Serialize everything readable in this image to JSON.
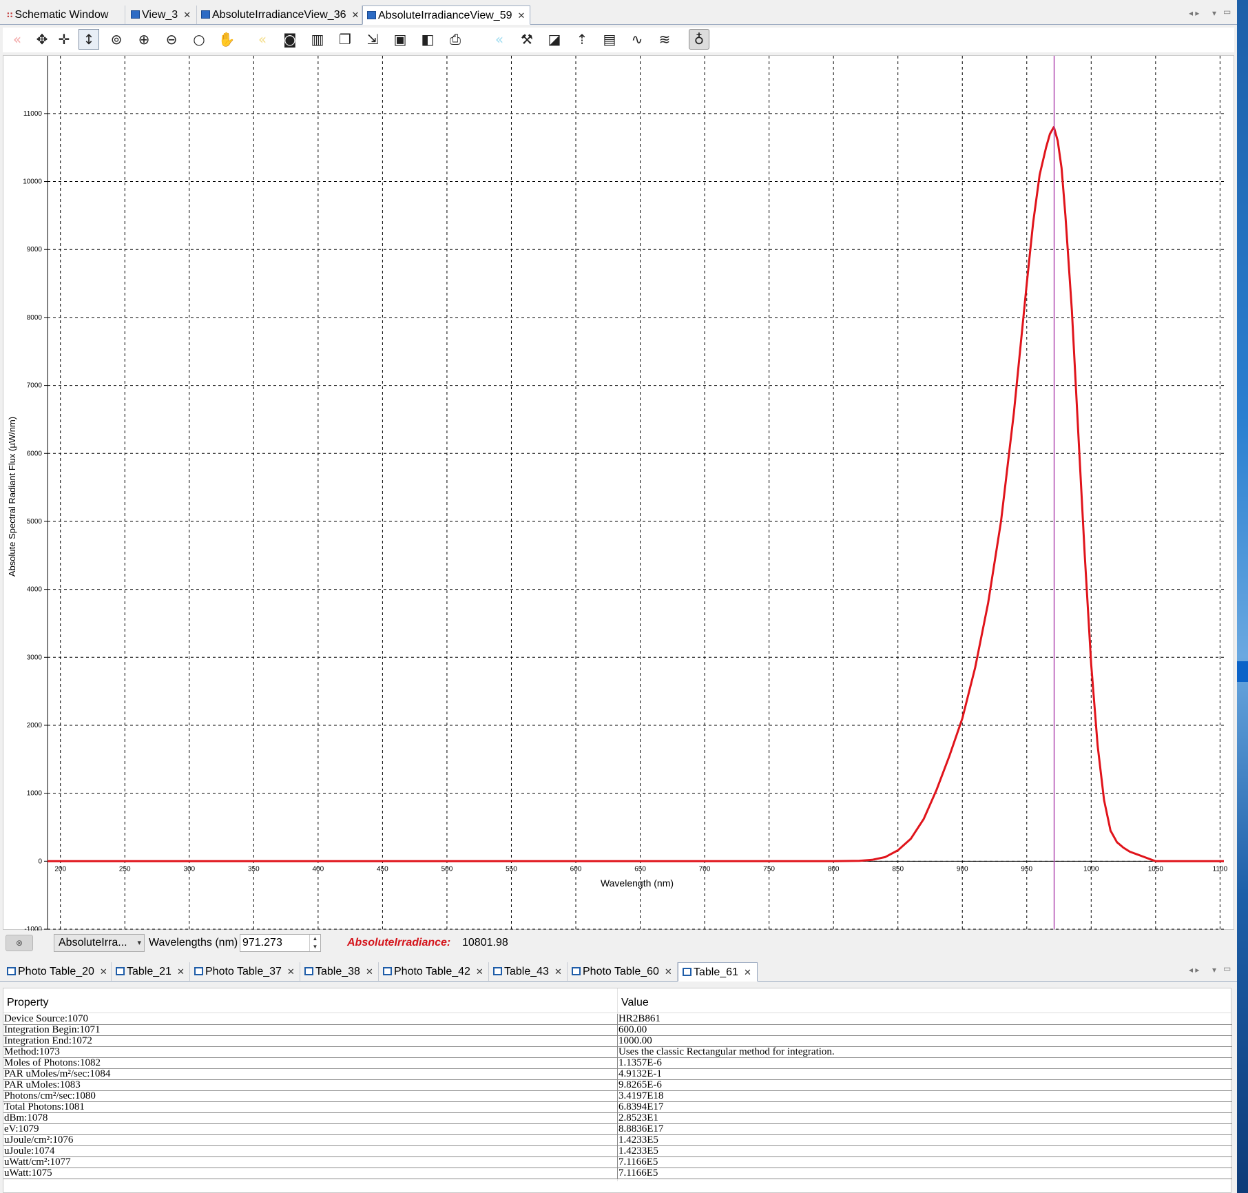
{
  "editor_tabs": [
    {
      "label": "Schematic Window",
      "icon": "schematic-dots-icon",
      "closable": false,
      "active": false
    },
    {
      "label": "View_3",
      "icon": "graph-view-icon",
      "closable": true,
      "active": false
    },
    {
      "label": "AbsoluteIrradianceView_36",
      "icon": "graph-view-icon",
      "closable": true,
      "active": false
    },
    {
      "label": "AbsoluteIrradianceView_59",
      "icon": "graph-view-icon",
      "closable": true,
      "active": true
    }
  ],
  "toolbar": {
    "buttons": [
      "back-icon",
      "pan-both-icon",
      "crosshair-icon",
      "vertical-cursor-icon",
      "zoom-auto-icon",
      "zoom-in-icon",
      "zoom-out-icon",
      "zoom-fit-icon",
      "hand-pan-icon",
      "back-yellow-icon",
      "camera-icon",
      "trash-icon",
      "copy-icon",
      "export-icon",
      "save-icon",
      "save-as-icon",
      "print-icon",
      "back-cyan-icon",
      "tools-icon",
      "overlay-icon",
      "peak-icon",
      "table-icon",
      "spectrum-icon",
      "multi-spectrum-icon",
      "bulb-icon"
    ],
    "accent_colors": {
      "faded_red": "#f3a6a6",
      "faded_yellow": "#f4dd86",
      "faded_cyan": "#9fdcf0"
    }
  },
  "chart_data": {
    "type": "line",
    "xlabel": "Wavelength (nm)",
    "ylabel": "Absolute Spectral Radiant Flux (µW/nm)",
    "xlim": [
      190,
      1103
    ],
    "ylim": [
      -1000,
      11850
    ],
    "x_ticks": [
      200,
      250,
      300,
      350,
      400,
      450,
      500,
      550,
      600,
      650,
      700,
      750,
      800,
      850,
      900,
      950,
      1000,
      1050,
      1100
    ],
    "y_ticks": [
      -1000,
      0,
      1000,
      2000,
      3000,
      4000,
      5000,
      6000,
      7000,
      8000,
      9000,
      10000,
      11000
    ],
    "grid": true,
    "grid_style": "dashed",
    "line_color": "#e0141b",
    "cursor_color": "#b04ab0",
    "cursor_x": 971.273,
    "series": [
      {
        "x": [
          190,
          800,
          820,
          830,
          840,
          850,
          860,
          870,
          880,
          890,
          900,
          910,
          920,
          930,
          940,
          950,
          955,
          960,
          965,
          968,
          971,
          974,
          977,
          980,
          985,
          990,
          995,
          1000,
          1005,
          1010,
          1015,
          1020,
          1025,
          1030,
          1040,
          1050,
          1103
        ],
        "y": [
          0,
          0,
          5,
          20,
          60,
          160,
          330,
          620,
          1050,
          1550,
          2100,
          2850,
          3800,
          5000,
          6600,
          8500,
          9400,
          10100,
          10500,
          10700,
          10802,
          10600,
          10200,
          9500,
          8100,
          6300,
          4500,
          2900,
          1700,
          900,
          450,
          280,
          200,
          140,
          70,
          0,
          0
        ]
      }
    ]
  },
  "status": {
    "combo_value": "AbsoluteIrra...",
    "wavelength_label": "Wavelengths (nm)",
    "wavelength_value": "971.273",
    "readout_label": "AbsoluteIrradiance:",
    "readout_value": "10801.98",
    "readout_color": "#d4141b"
  },
  "bottom_tabs": [
    {
      "label": "Photo Table_20"
    },
    {
      "label": "Table_21"
    },
    {
      "label": "Photo Table_37"
    },
    {
      "label": "Table_38"
    },
    {
      "label": "Photo Table_42"
    },
    {
      "label": "Table_43"
    },
    {
      "label": "Photo Table_60"
    },
    {
      "label": "Table_61",
      "active": true
    }
  ],
  "table": {
    "headers": [
      "Property",
      "Value"
    ],
    "rows": [
      [
        "Device Source:1070",
        "HR2B861"
      ],
      [
        "Integration Begin:1071",
        "600.00"
      ],
      [
        "Integration End:1072",
        "1000.00"
      ],
      [
        "Method:1073",
        "Uses the classic Rectangular method for integration."
      ],
      [
        "Moles of Photons:1082",
        "1.1357E-6"
      ],
      [
        "PAR uMoles/m²/sec:1084",
        "4.9132E-1"
      ],
      [
        "PAR uMoles:1083",
        "9.8265E-6"
      ],
      [
        "Photons/cm²/sec:1080",
        "3.4197E18"
      ],
      [
        "Total Photons:1081",
        "6.8394E17"
      ],
      [
        "dBm:1078",
        "2.8523E1"
      ],
      [
        "eV:1079",
        "8.8836E17"
      ],
      [
        "uJoule/cm²:1076",
        "1.4233E5"
      ],
      [
        "uJoule:1074",
        "1.4233E5"
      ],
      [
        "uWatt/cm²:1077",
        "7.1166E5"
      ],
      [
        "uWatt:1075",
        "7.1166E5"
      ]
    ]
  }
}
